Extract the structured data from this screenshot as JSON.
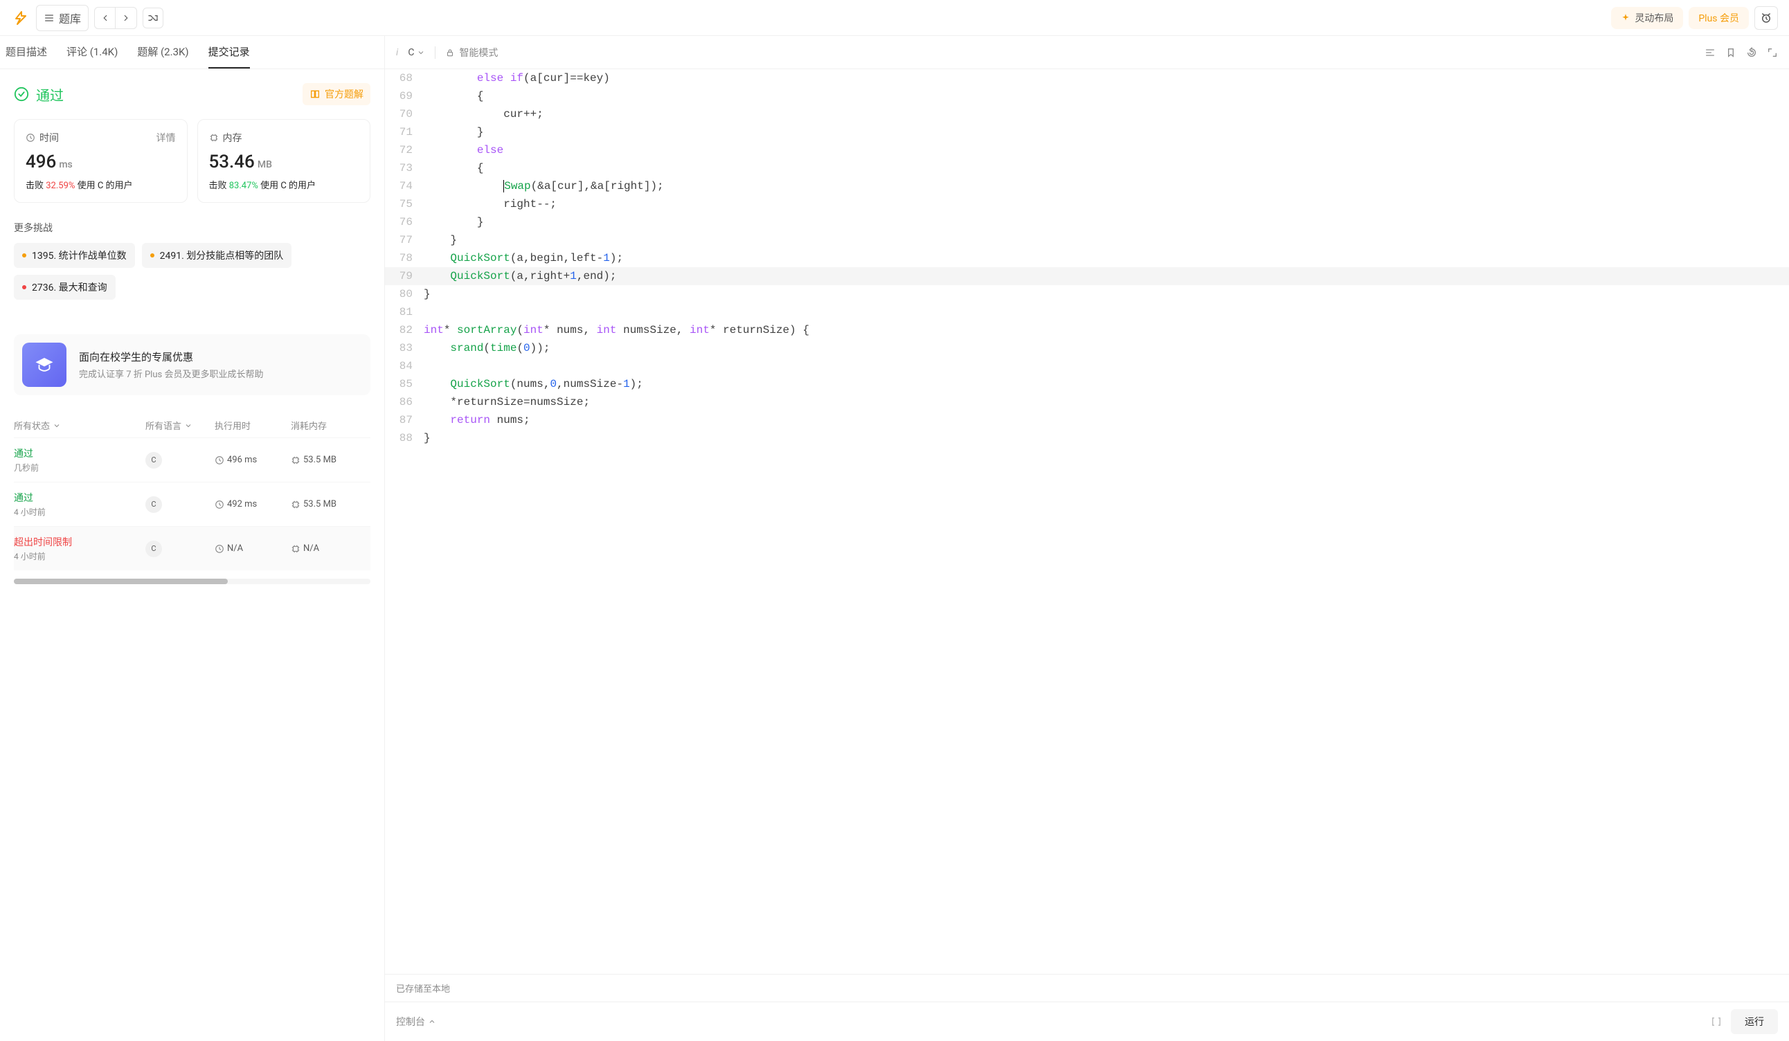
{
  "topbar": {
    "library": "题库",
    "smart_layout": "灵动布局",
    "plus": "Plus 会员"
  },
  "tabs": {
    "desc": "题目描述",
    "discuss": "评论 (1.4K)",
    "solutions": "题解 (2.3K)",
    "submissions": "提交记录"
  },
  "result": {
    "status": "通过",
    "official_solution": "官方题解"
  },
  "time_card": {
    "label": "时间",
    "details": "详情",
    "value": "496",
    "unit": "ms",
    "sub_prefix": "击败 ",
    "pct": "32.59%",
    "sub_suffix": " 使用 C 的用户"
  },
  "mem_card": {
    "label": "内存",
    "value": "53.46",
    "unit": "MB",
    "sub_prefix": "击败 ",
    "pct": "83.47%",
    "sub_suffix": " 使用 C 的用户"
  },
  "more_title": "更多挑战",
  "challenges": [
    {
      "label": "1395. 统计作战单位数"
    },
    {
      "label": "2491. 划分技能点相等的团队"
    },
    {
      "label": "2736. 最大和查询"
    }
  ],
  "promo": {
    "title": "面向在校学生的专属优惠",
    "sub": "完成认证享 7 折 Plus 会员及更多职业成长帮助"
  },
  "subs_head": {
    "status": "所有状态",
    "lang": "所有语言",
    "time": "执行用时",
    "mem": "消耗内存"
  },
  "subs": [
    {
      "status": "通过",
      "ok": true,
      "ago": "几秒前",
      "lang": "C",
      "time": "496 ms",
      "mem": "53.5 MB"
    },
    {
      "status": "通过",
      "ok": true,
      "ago": "4 小时前",
      "lang": "C",
      "time": "492 ms",
      "mem": "53.5 MB"
    },
    {
      "status": "超出时间限制",
      "ok": false,
      "ago": "4 小时前",
      "lang": "C",
      "time": "N/A",
      "mem": "N/A"
    }
  ],
  "editor": {
    "lang": "C",
    "smart_mode": "智能模式"
  },
  "code": [
    {
      "n": 68,
      "html": "        <span class='kw'>else if</span>(a[cur]==key)"
    },
    {
      "n": 69,
      "html": "        {"
    },
    {
      "n": 70,
      "html": "            cur++;"
    },
    {
      "n": 71,
      "html": "        }"
    },
    {
      "n": 72,
      "html": "        <span class='kw'>else</span>"
    },
    {
      "n": 73,
      "html": "        {"
    },
    {
      "n": 74,
      "html": "            <span class='fn'>Swap</span>(&a[cur],&a[right]);",
      "cursor": true
    },
    {
      "n": 75,
      "html": "            right--;"
    },
    {
      "n": 76,
      "html": "        }"
    },
    {
      "n": 77,
      "html": "    }"
    },
    {
      "n": 78,
      "html": "    <span class='fn'>QuickSort</span>(a,begin,left-<span class='num'>1</span>);"
    },
    {
      "n": 79,
      "html": "    <span class='fn'>QuickSort</span>(a,right+<span class='num'>1</span>,end);",
      "hl": true
    },
    {
      "n": 80,
      "html": "}"
    },
    {
      "n": 81,
      "html": ""
    },
    {
      "n": 82,
      "html": "<span class='type'>int</span>* <span class='fn'>sortArray</span>(<span class='type'>int</span>* nums, <span class='type'>int</span> numsSize, <span class='type'>int</span>* returnSize) {"
    },
    {
      "n": 83,
      "html": "    <span class='fn'>srand</span>(<span class='fn'>time</span>(<span class='num'>0</span>));"
    },
    {
      "n": 84,
      "html": ""
    },
    {
      "n": 85,
      "html": "    <span class='fn'>QuickSort</span>(nums,<span class='num'>0</span>,numsSize-<span class='num'>1</span>);"
    },
    {
      "n": 86,
      "html": "    *returnSize=numsSize;"
    },
    {
      "n": 87,
      "html": "    <span class='kw'>return</span> nums;"
    },
    {
      "n": 88,
      "html": "}"
    }
  ],
  "save_status": "已存储至本地",
  "console": {
    "label": "控制台",
    "run": "运行"
  }
}
